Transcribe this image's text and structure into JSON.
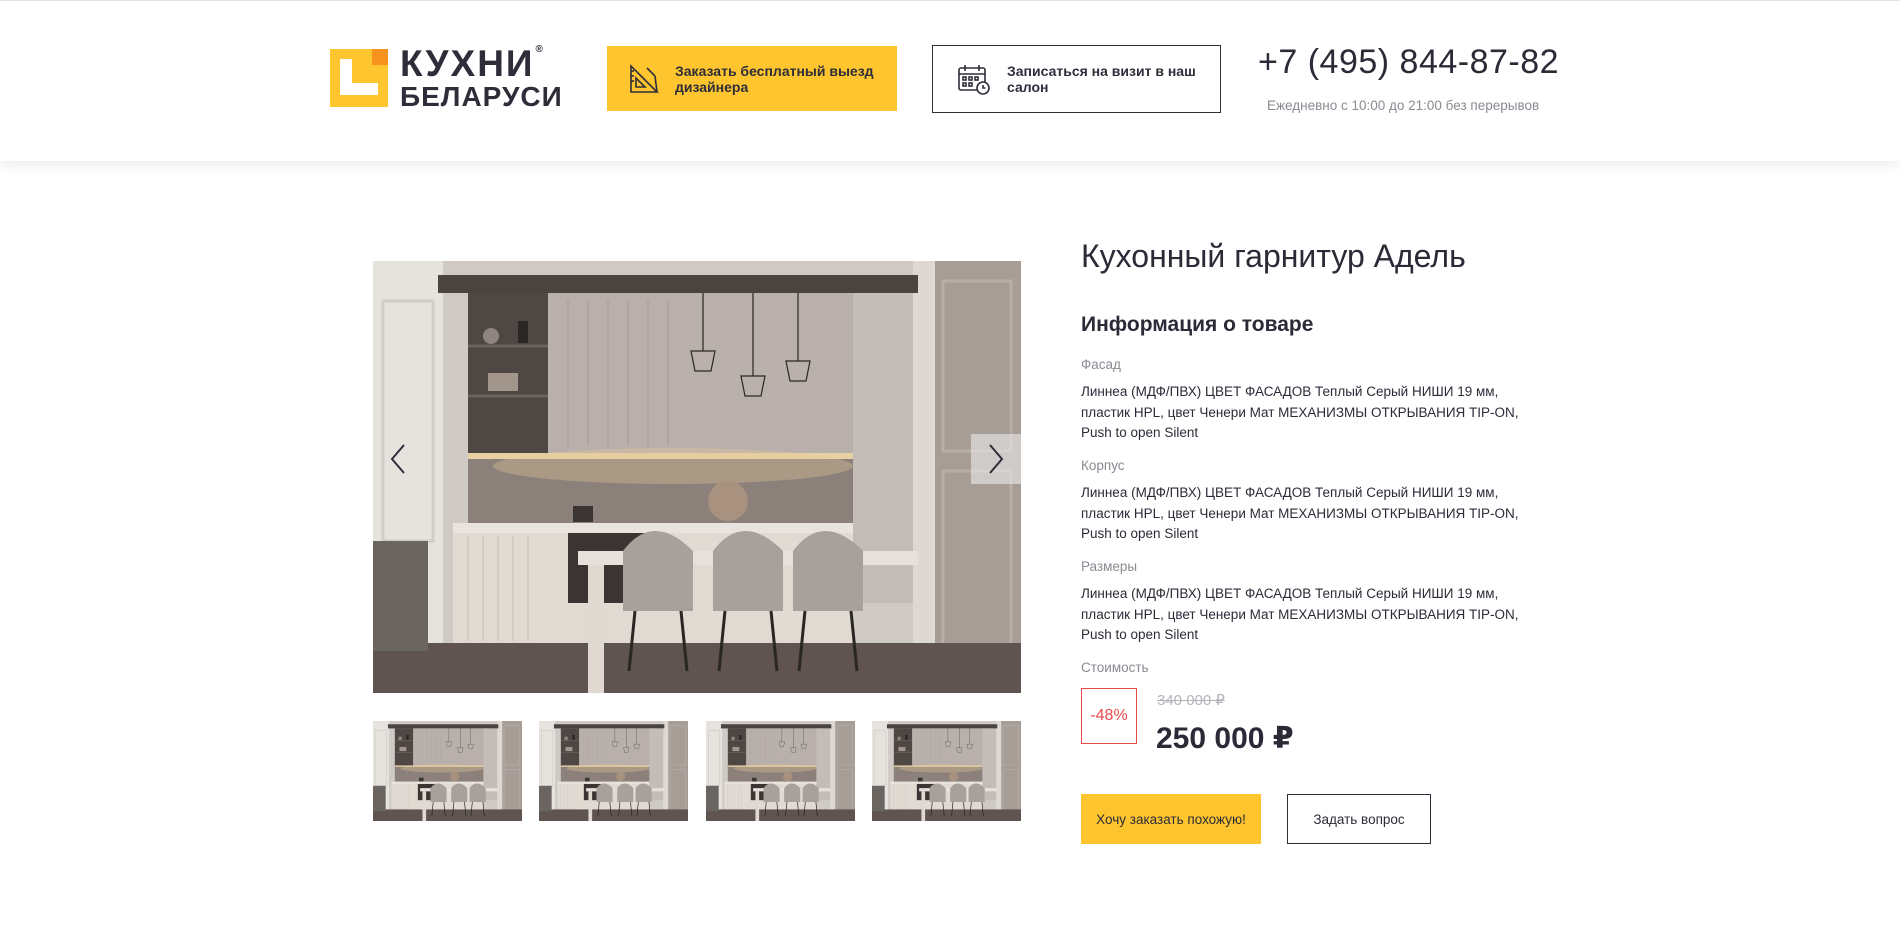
{
  "header": {
    "logo": {
      "line1": "КУХНИ",
      "line2": "БЕЛАРУСИ",
      "reg": "®"
    },
    "designer_button": {
      "label": "Заказать бесплатный выезд дизайнера",
      "icon": "ruler-triangle-icon"
    },
    "visit_button": {
      "label": "Записаться на визит в наш салон",
      "icon": "calendar-clock-icon"
    },
    "phone": "+7 (495) 844-87-82",
    "hours": "Ежедневно с 10:00 до 21:00 без перерывов"
  },
  "product": {
    "title": "Кухонный гарнитур Адель",
    "info_heading": "Информация о товаре",
    "specs": [
      {
        "label": "Фасад",
        "text": "Линнеа (МДФ/ПВХ) ЦВЕТ ФАСАДОВ Теплый Серый НИШИ 19 мм, пластик HPL, цвет Ченери Мат МЕХАНИЗМЫ ОТКРЫВАНИЯ TIP-ON, Push to open Silent"
      },
      {
        "label": "Корпус",
        "text": "Линнеа (МДФ/ПВХ) ЦВЕТ ФАСАДОВ Теплый Серый НИШИ 19 мм, пластик HPL, цвет Ченери Мат МЕХАНИЗМЫ ОТКРЫВАНИЯ TIP-ON, Push to open Silent"
      },
      {
        "label": "Размеры",
        "text": "Линнеа (МДФ/ПВХ) ЦВЕТ ФАСАДОВ Теплый Серый НИШИ 19 мм, пластик HPL, цвет Ченери Мат МЕХАНИЗМЫ ОТКРЫВАНИЯ TIP-ON, Push to open Silent"
      }
    ],
    "price": {
      "label": "Стоимость",
      "discount": "-48%",
      "old": "340 000 ₽",
      "new": "250 000 ₽"
    },
    "order_button": "Хочу заказать похожую!",
    "ask_button": "Задать вопрос"
  },
  "gallery": {
    "prev_icon": "chevron-left-icon",
    "next_icon": "chevron-right-icon",
    "thumbnail_count": 4
  },
  "colors": {
    "accent": "#fec52e",
    "logo_orange": "#f7931e",
    "text": "#2b2b38",
    "muted": "#8a8a92",
    "discount": "#e84a4a"
  }
}
